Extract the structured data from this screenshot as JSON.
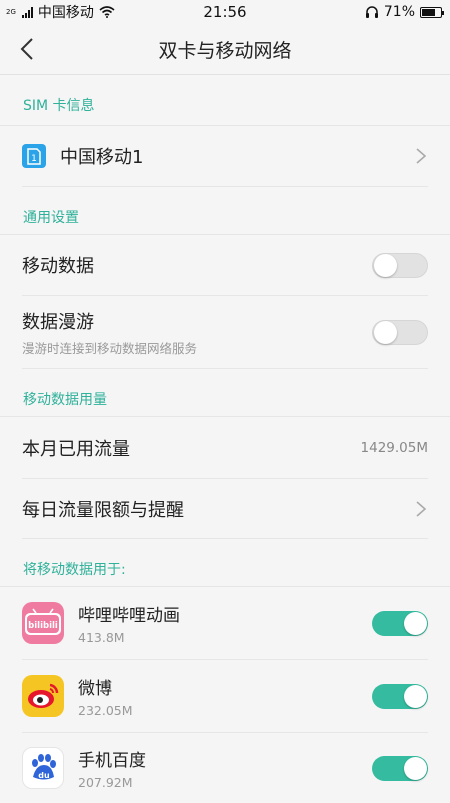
{
  "status": {
    "network_tag": "2G",
    "carrier": "中国移动",
    "time": "21:56",
    "battery": "71%",
    "battery_level": 0.71
  },
  "header": {
    "title": "双卡与移动网络"
  },
  "sim_section": {
    "title": "SIM 卡信息",
    "sim_label": "中国移动1",
    "sim_number": "1"
  },
  "general_section": {
    "title": "通用设置",
    "mobile_data": {
      "label": "移动数据",
      "enabled": false
    },
    "roaming": {
      "label": "数据漫游",
      "sub": "漫游时连接到移动数据网络服务",
      "enabled": false
    }
  },
  "usage_section": {
    "title": "移动数据用量",
    "month_used_label": "本月已用流量",
    "month_used_value": "1429.05M",
    "daily_limit_label": "每日流量限额与提醒"
  },
  "apps_section": {
    "title": "将移动数据用于:",
    "apps": [
      {
        "name": "哔哩哔哩动画",
        "size": "413.8M",
        "enabled": true,
        "icon": "bilibili-icon",
        "icon_text": "bilibili",
        "color": "#f07ba0"
      },
      {
        "name": "微博",
        "size": "232.05M",
        "enabled": true,
        "icon": "weibo-icon",
        "color": "#f5c623"
      },
      {
        "name": "手机百度",
        "size": "207.92M",
        "enabled": true,
        "icon": "baidu-icon",
        "icon_text": "du",
        "color": "#2f65d8"
      }
    ]
  },
  "colors": {
    "accent": "#2fb19a",
    "toggle_on": "#35bca0",
    "sim_blue": "#2aa3e8"
  }
}
